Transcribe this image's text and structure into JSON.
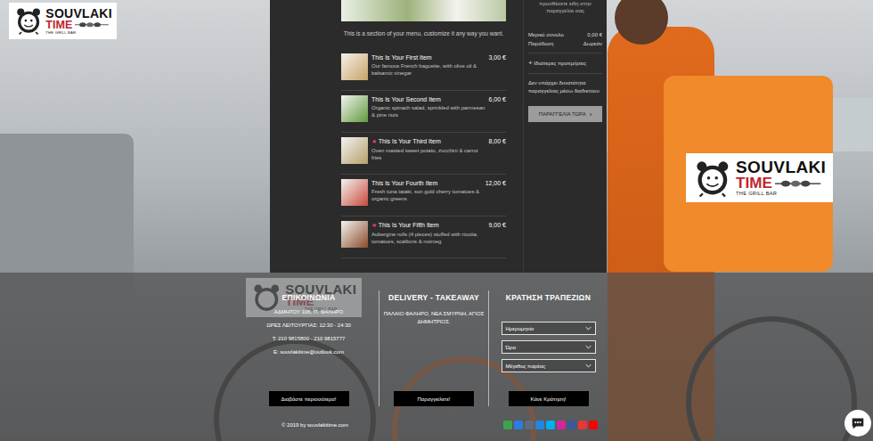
{
  "logo": {
    "title": "SOUVLAKI",
    "subtitle": "TIME",
    "tagline": "THE GRILL BAR"
  },
  "menu": {
    "intro": "This is a section of your menu, customize it any way you want.",
    "star": "★",
    "items": [
      {
        "name": "This Is Your First Item",
        "description": "Our famous French baguette, with olive oil & balsamic vinegar",
        "price": "3,00 €",
        "featured": false
      },
      {
        "name": "This Is Your Second Item",
        "description": "Organic spinach salad, sprinkled with parmesan & pine nuts",
        "price": "6,00 €",
        "featured": false
      },
      {
        "name": "This Is Your Third Item",
        "description": "Oven roasted sweet potato, zucchini & carrot fries",
        "price": "8,00 €",
        "featured": true
      },
      {
        "name": "This Is Your Fourth Item",
        "description": "Fresh tuna tataki, sun gold cherry tomatoes & organic greens",
        "price": "12,00 €",
        "featured": false
      },
      {
        "name": "This Is Your Fifth Item",
        "description": "Aubergine rolls (4 pieces) stuffed with ricotta, tomatoes, scallions & nutmeg",
        "price": "9,00 €",
        "featured": true
      }
    ]
  },
  "cart": {
    "empty_message": [
      "προσθέσετε είδη στην",
      "παραγγελία σας"
    ],
    "summary": [
      {
        "label": "Μερικό σύνολο",
        "value": "0,00 €"
      },
      {
        "label": "Παράδοση",
        "value": "Δωρεάν"
      }
    ],
    "preferences": {
      "icon": "+",
      "label": "Ιδιαίτερες προτιμήσεις"
    },
    "notice": "Δεν υπάρχει δυνατότητα παραγγελίας μέσω διαδικτύου",
    "order_button": {
      "label": "ΠΑΡΑΓΓΕΛΙΑ ΤΩΡΑ",
      "icon": "›"
    }
  },
  "footer": {
    "contact": {
      "title": "ΕΠΙΚΟΙΝΩΝΙΑ",
      "lines": [
        "ΑΔΜΗΤΟΥ 106, Π. ΦΑΛΗΡΟ",
        "ΩΡΕΣ ΛΕΙΤΟΥΡΓΙΑΣ: 12:30 - 24:30",
        "T: 210 9815800 - 210 9815777",
        "E: souvlakitime@outlook.com"
      ],
      "button": "Διαβάστε περισσότερα!"
    },
    "delivery": {
      "title": "DELIVERY - TAKEAWAY",
      "areas": "ΠΑΛΑΙΟ ΦΑΛΗΡΟ, ΝΕΑ ΣΜΥΡΝΗ, ΑΓΙΟΣ ΔΗΜΗΤΡΙΟΣ.",
      "button": "Παραγγείλετε!"
    },
    "reservation": {
      "title": "ΚΡΑΤΗΣΗ ΤΡΑΠΕΖΙΩΝ",
      "fields": [
        "Ημερομηνία",
        "Ώρα",
        "Μέγεθος παρέας"
      ],
      "button": "Κάνε Κράτηση!"
    },
    "copyright": "© 2019 by souvlakitime.com",
    "social": [
      {
        "color": "#3fa34d"
      },
      {
        "color": "#2b7de1"
      },
      {
        "color": "#5f6b7a"
      },
      {
        "color": "#1e88e5"
      },
      {
        "color": "#00aff0"
      },
      {
        "color": "#d6249f"
      },
      {
        "color": "#3b5998"
      },
      {
        "color": "#e53935"
      },
      {
        "color": "#ff0000"
      }
    ]
  }
}
